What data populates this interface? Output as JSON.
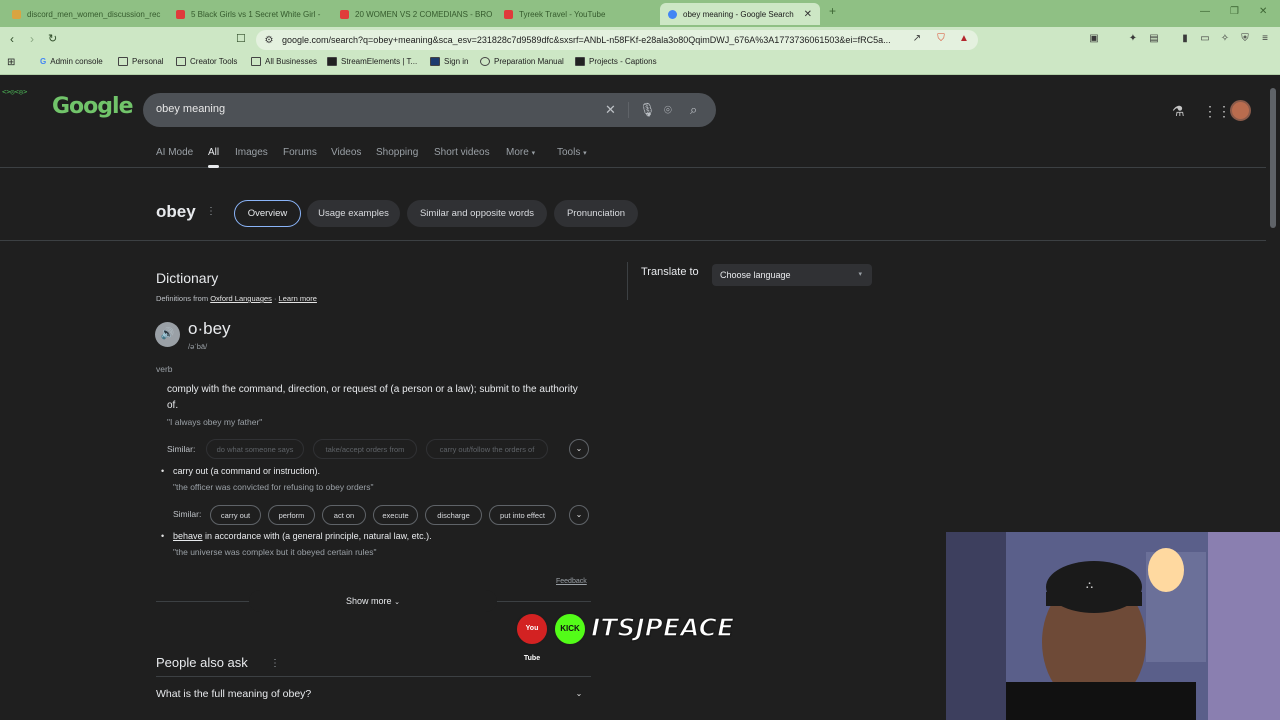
{
  "browser": {
    "tabs": [
      {
        "label": "discord_men_women_discussion_rec",
        "color": "#d9a441"
      },
      {
        "label": "5 Black Girls vs 1 Secret White Girl -",
        "color": "#e03b3b"
      },
      {
        "label": "20 WOMEN VS 2 COMEDIANS - BRO",
        "color": "#e03b3b"
      },
      {
        "label": "Tyreek Travel - YouTube",
        "color": "#e03b3b"
      },
      {
        "label": "obey meaning - Google Search",
        "color": "#4285f4"
      }
    ],
    "new_tab_label": "+",
    "url": "google.com/search?q=obey+meaning&sca_esv=231828c7d9589dfc&sxsrf=ANbL-n58FKf-e28ala3o80QqimDWJ_676A%3A1773736061503&ei=fRC5a...",
    "bookmarks": [
      "Admin console",
      "Personal",
      "Creator Tools",
      "All Businesses",
      "StreamElements | T...",
      "Sign in",
      "Preparation Manual",
      "Projects - Captions"
    ]
  },
  "google": {
    "logo": "Google",
    "query": "obey meaning",
    "tabs": [
      "AI Mode",
      "All",
      "Images",
      "Forums",
      "Videos",
      "Shopping",
      "Short videos",
      "More",
      "Tools"
    ],
    "word": "obey",
    "chips": [
      "Overview",
      "Usage examples",
      "Similar and opposite words",
      "Pronunciation"
    ]
  },
  "dictionary": {
    "title": "Dictionary",
    "source_prefix": "Definitions from",
    "source": "Oxford Languages",
    "learn_more": "Learn more",
    "headword": "o·bey",
    "pronunciation": "/əˈbā/",
    "pos": "verb",
    "definition": "comply with the command, direction, or request of (a person or a law); submit to the authority of.",
    "example": "\"I always obey my father\"",
    "similar_label": "Similar:",
    "similar1": [
      "do what someone says",
      "take/accept orders from",
      "carry out/follow the orders of"
    ],
    "sub1_def": "carry out (a command or instruction).",
    "sub1_example": "\"the officer was convicted for refusing to obey orders\"",
    "similar2": [
      "carry out",
      "perform",
      "act on",
      "execute",
      "discharge",
      "put into effect"
    ],
    "sub2_link": "behave",
    "sub2_def": "in accordance with (a general principle, natural law, etc.).",
    "sub2_example": "\"the universe was complex but it obeyed certain rules\"",
    "feedback": "Feedback",
    "show_more": "Show more"
  },
  "translate": {
    "label": "Translate to",
    "select": "Choose language"
  },
  "paa": {
    "title": "People also ask",
    "q1": "What is the full meaning of obey?"
  },
  "overlay": {
    "yt": "You Tube",
    "kick": "KICK",
    "channel": "ITSJPEACE"
  }
}
